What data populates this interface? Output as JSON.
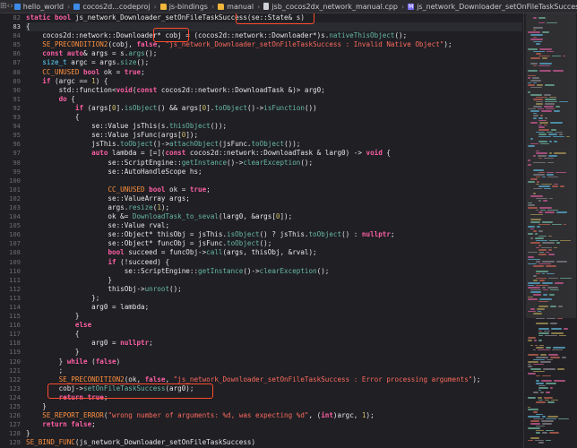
{
  "breadcrumb": {
    "items": [
      {
        "label": "hello_world",
        "icon": "project-icon"
      },
      {
        "label": "cocos2d...codeproj",
        "icon": "project-icon"
      },
      {
        "label": "js-bindings",
        "icon": "folder-icon"
      },
      {
        "label": "manual",
        "icon": "folder-icon"
      },
      {
        "label": "jsb_cocos2dx_network_manual.cpp",
        "icon": "file-icon"
      },
      {
        "label": "js_network_Downloader_setOnFileTaskSuccess(s)",
        "icon": "function-icon"
      }
    ]
  },
  "editor": {
    "line_start": 82,
    "active_line": 83,
    "lines": [
      [
        [
          "kw",
          "static "
        ],
        [
          "kw",
          "bool "
        ],
        [
          "pl",
          "js_network_Downloader_setOnFileTaskSuccess(se::State& s)"
        ]
      ],
      [
        [
          "pl",
          "{"
        ]
      ],
      [
        [
          "pl",
          "    cocos2d::network::Downloader* cobj = (cocos2d::network::Downloader*)s."
        ],
        [
          "fn",
          "nativeThisObject"
        ],
        [
          "pl",
          "();"
        ]
      ],
      [
        [
          "pl",
          "    "
        ],
        [
          "mac",
          "SE_PRECONDITION2"
        ],
        [
          "pl",
          "(cobj, "
        ],
        [
          "kw",
          "false"
        ],
        [
          "pl",
          ", "
        ],
        [
          "str",
          "\"js_network_Downloader_setOnFileTaskSuccess : Invalid Native Object\""
        ],
        [
          "pl",
          ");"
        ]
      ],
      [
        [
          "pl",
          "    "
        ],
        [
          "kw",
          "const auto"
        ],
        [
          "pl",
          "& args = s."
        ],
        [
          "fn",
          "args"
        ],
        [
          "pl",
          "();"
        ]
      ],
      [
        [
          "pl",
          "    "
        ],
        [
          "ty",
          "size_t"
        ],
        [
          "pl",
          " argc = args."
        ],
        [
          "fn",
          "size"
        ],
        [
          "pl",
          "();"
        ]
      ],
      [
        [
          "pl",
          "    "
        ],
        [
          "mac",
          "CC_UNUSED"
        ],
        [
          "pl",
          " "
        ],
        [
          "kw",
          "bool"
        ],
        [
          "pl",
          " ok = "
        ],
        [
          "kw",
          "true"
        ],
        [
          "pl",
          ";"
        ]
      ],
      [
        [
          "pl",
          "    "
        ],
        [
          "kw",
          "if"
        ],
        [
          "pl",
          " (argc == "
        ],
        [
          "num",
          "1"
        ],
        [
          "pl",
          ") {"
        ]
      ],
      [
        [
          "pl",
          "        std::function<"
        ],
        [
          "kw",
          "void"
        ],
        [
          "pl",
          "("
        ],
        [
          "kw",
          "const"
        ],
        [
          "pl",
          " cocos2d::network::DownloadTask &)> arg0;"
        ]
      ],
      [
        [
          "pl",
          "        "
        ],
        [
          "kw",
          "do"
        ],
        [
          "pl",
          " {"
        ]
      ],
      [
        [
          "pl",
          "            "
        ],
        [
          "kw",
          "if"
        ],
        [
          "pl",
          " (args["
        ],
        [
          "num",
          "0"
        ],
        [
          "pl",
          "]."
        ],
        [
          "fn",
          "isObject"
        ],
        [
          "pl",
          "() && args["
        ],
        [
          "num",
          "0"
        ],
        [
          "pl",
          "]."
        ],
        [
          "fn",
          "toObject"
        ],
        [
          "pl",
          "()->"
        ],
        [
          "fn",
          "isFunction"
        ],
        [
          "pl",
          "())"
        ]
      ],
      [
        [
          "pl",
          "            {"
        ]
      ],
      [
        [
          "pl",
          "                se::Value jsThis(s."
        ],
        [
          "fn",
          "thisObject"
        ],
        [
          "pl",
          "());"
        ]
      ],
      [
        [
          "pl",
          "                se::Value jsFunc(args["
        ],
        [
          "num",
          "0"
        ],
        [
          "pl",
          "]);"
        ]
      ],
      [
        [
          "pl",
          "                jsThis."
        ],
        [
          "fn",
          "toObject"
        ],
        [
          "pl",
          "()->"
        ],
        [
          "fn",
          "attachObject"
        ],
        [
          "pl",
          "(jsFunc."
        ],
        [
          "fn",
          "toObject"
        ],
        [
          "pl",
          "());"
        ]
      ],
      [
        [
          "pl",
          "                "
        ],
        [
          "kw",
          "auto"
        ],
        [
          "pl",
          " lambda = [=]("
        ],
        [
          "kw",
          "const"
        ],
        [
          "pl",
          " cocos2d::network::DownloadTask & larg0) -> "
        ],
        [
          "kw",
          "void"
        ],
        [
          "pl",
          " {"
        ]
      ],
      [
        [
          "pl",
          "                    se::ScriptEngine::"
        ],
        [
          "fn",
          "getInstance"
        ],
        [
          "pl",
          "()->"
        ],
        [
          "fn",
          "clearException"
        ],
        [
          "pl",
          "();"
        ]
      ],
      [
        [
          "pl",
          "                    se::AutoHandleScope hs;"
        ]
      ],
      [
        [
          "pl",
          ""
        ]
      ],
      [
        [
          "pl",
          "                    "
        ],
        [
          "mac",
          "CC_UNUSED"
        ],
        [
          "pl",
          " "
        ],
        [
          "kw",
          "bool"
        ],
        [
          "pl",
          " ok = "
        ],
        [
          "kw",
          "true"
        ],
        [
          "pl",
          ";"
        ]
      ],
      [
        [
          "pl",
          "                    se::ValueArray args;"
        ]
      ],
      [
        [
          "pl",
          "                    args."
        ],
        [
          "fn",
          "resize"
        ],
        [
          "pl",
          "("
        ],
        [
          "num",
          "1"
        ],
        [
          "pl",
          ");"
        ]
      ],
      [
        [
          "pl",
          "                    ok &= "
        ],
        [
          "fn",
          "DownloadTask_to_seval"
        ],
        [
          "pl",
          "(larg0, &args["
        ],
        [
          "num",
          "0"
        ],
        [
          "pl",
          "]);"
        ]
      ],
      [
        [
          "pl",
          "                    se::Value rval;"
        ]
      ],
      [
        [
          "pl",
          "                    se::Object* thisObj = jsThis."
        ],
        [
          "fn",
          "isObject"
        ],
        [
          "pl",
          "() ? jsThis."
        ],
        [
          "fn",
          "toObject"
        ],
        [
          "pl",
          "() : "
        ],
        [
          "kw",
          "nullptr"
        ],
        [
          "pl",
          ";"
        ]
      ],
      [
        [
          "pl",
          "                    se::Object* funcObj = jsFunc."
        ],
        [
          "fn",
          "toObject"
        ],
        [
          "pl",
          "();"
        ]
      ],
      [
        [
          "pl",
          "                    "
        ],
        [
          "kw",
          "bool"
        ],
        [
          "pl",
          " succeed = funcObj->"
        ],
        [
          "fn",
          "call"
        ],
        [
          "pl",
          "(args, thisObj, &rval);"
        ]
      ],
      [
        [
          "pl",
          "                    "
        ],
        [
          "kw",
          "if"
        ],
        [
          "pl",
          " (!succeed) {"
        ]
      ],
      [
        [
          "pl",
          "                        se::ScriptEngine::"
        ],
        [
          "fn",
          "getInstance"
        ],
        [
          "pl",
          "()->"
        ],
        [
          "fn",
          "clearException"
        ],
        [
          "pl",
          "();"
        ]
      ],
      [
        [
          "pl",
          "                    }"
        ]
      ],
      [
        [
          "pl",
          "                    thisObj->"
        ],
        [
          "fn",
          "unroot"
        ],
        [
          "pl",
          "();"
        ]
      ],
      [
        [
          "pl",
          "                };"
        ]
      ],
      [
        [
          "pl",
          "                arg0 = lambda;"
        ]
      ],
      [
        [
          "pl",
          "            }"
        ]
      ],
      [
        [
          "pl",
          "            "
        ],
        [
          "kw",
          "else"
        ]
      ],
      [
        [
          "pl",
          "            {"
        ]
      ],
      [
        [
          "pl",
          "                arg0 = "
        ],
        [
          "kw",
          "nullptr"
        ],
        [
          "pl",
          ";"
        ]
      ],
      [
        [
          "pl",
          "            }"
        ]
      ],
      [
        [
          "pl",
          "        } "
        ],
        [
          "kw",
          "while"
        ],
        [
          "pl",
          " ("
        ],
        [
          "kw",
          "false"
        ],
        [
          "pl",
          ")"
        ]
      ],
      [
        [
          "pl",
          "        ;"
        ]
      ],
      [
        [
          "pl",
          "        "
        ],
        [
          "mac",
          "SE_PRECONDITION2"
        ],
        [
          "pl",
          "(ok, "
        ],
        [
          "kw",
          "false"
        ],
        [
          "pl",
          ", "
        ],
        [
          "str",
          "\"js_network_Downloader_setOnFileTaskSuccess : Error processing arguments\""
        ],
        [
          "pl",
          ");"
        ]
      ],
      [
        [
          "pl",
          "        cobj->"
        ],
        [
          "fn",
          "setOnFileTaskSuccess"
        ],
        [
          "pl",
          "(arg0);"
        ]
      ],
      [
        [
          "pl",
          "        "
        ],
        [
          "kw",
          "return true"
        ],
        [
          "pl",
          ";"
        ]
      ],
      [
        [
          "pl",
          "    }"
        ]
      ],
      [
        [
          "pl",
          "    "
        ],
        [
          "mac",
          "SE_REPORT_ERROR"
        ],
        [
          "pl",
          "("
        ],
        [
          "str",
          "\"wrong number of arguments: %d, was expecting %d\""
        ],
        [
          "pl",
          ", ("
        ],
        [
          "kw",
          "int"
        ],
        [
          "pl",
          ")argc, "
        ],
        [
          "num",
          "1"
        ],
        [
          "pl",
          ");"
        ]
      ],
      [
        [
          "pl",
          "    "
        ],
        [
          "kw",
          "return false"
        ],
        [
          "pl",
          ";"
        ]
      ],
      [
        [
          "pl",
          "}"
        ]
      ],
      [
        [
          "mac",
          "SE_BIND_FUNC"
        ],
        [
          "pl",
          "(js_network_Downloader_setOnFileTaskSuccess)"
        ]
      ]
    ]
  },
  "colors": {
    "keyword": "#fc5fa3",
    "type": "#5dd8ff",
    "function": "#67b7a4",
    "string": "#fc6a5d",
    "number": "#d0bf69",
    "macro": "#fd8f3f",
    "highlight_box": "#ff4b2b"
  }
}
